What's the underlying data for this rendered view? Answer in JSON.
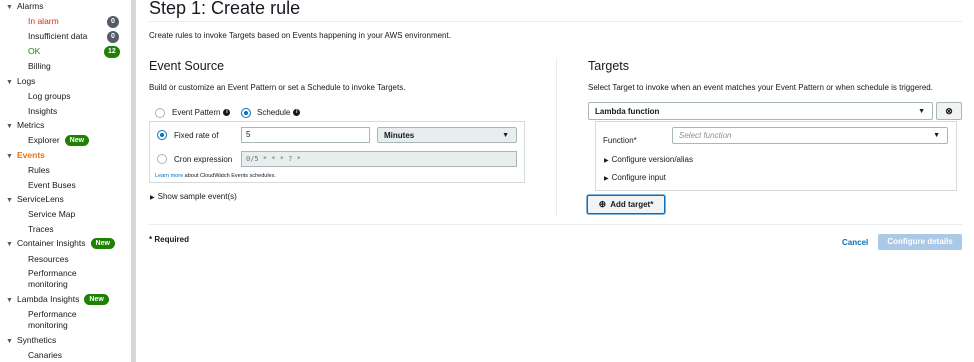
{
  "sidebar": {
    "alarms": "Alarms",
    "in_alarm": "In alarm",
    "in_alarm_count": "0",
    "insufficient_data": "Insufficient data",
    "insufficient_count": "0",
    "ok": "OK",
    "ok_count": "12",
    "billing": "Billing",
    "logs": "Logs",
    "log_groups": "Log groups",
    "insights": "Insights",
    "metrics": "Metrics",
    "explorer": "Explorer",
    "new_badge": "New",
    "events": "Events",
    "rules": "Rules",
    "event_buses": "Event Buses",
    "servicelens": "ServiceLens",
    "service_map": "Service Map",
    "traces": "Traces",
    "container_insights": "Container Insights",
    "resources": "Resources",
    "performance_monitoring": "Performance monitoring",
    "lambda_insights": "Lambda Insights",
    "synthetics": "Synthetics",
    "canaries": "Canaries"
  },
  "page": {
    "title": "Step 1: Create rule",
    "description": "Create rules to invoke Targets based on Events happening in your AWS environment."
  },
  "event_source": {
    "heading": "Event Source",
    "description": "Build or customize an Event Pattern or set a Schedule to invoke Targets.",
    "event_pattern_label": "Event Pattern",
    "schedule_label": "Schedule",
    "fixed_rate_label": "Fixed rate of",
    "fixed_rate_value": "5",
    "unit_value": "Minutes",
    "cron_label": "Cron expression",
    "cron_value": "0/5 * * * ? *",
    "learn_more_link": "Learn more",
    "learn_more_rest": " about CloudWatch Events schedules.",
    "show_sample": "Show sample event(s)"
  },
  "targets": {
    "heading": "Targets",
    "description": "Select Target to invoke when an event matches your Event Pattern or when schedule is triggered.",
    "target_type": "Lambda function",
    "function_label": "Function*",
    "function_placeholder": "Select function",
    "configure_version": "Configure version/alias",
    "configure_input": "Configure input",
    "add_target": "Add target*"
  },
  "footer": {
    "required_note": "* Required",
    "cancel": "Cancel",
    "configure_details": "Configure details"
  },
  "colors": {
    "accent": "#0073bb",
    "active_nav": "#ec7211",
    "alarm": "#d13212",
    "ok_green": "#1d8102",
    "primary_disabled": "#a9c9e6"
  }
}
